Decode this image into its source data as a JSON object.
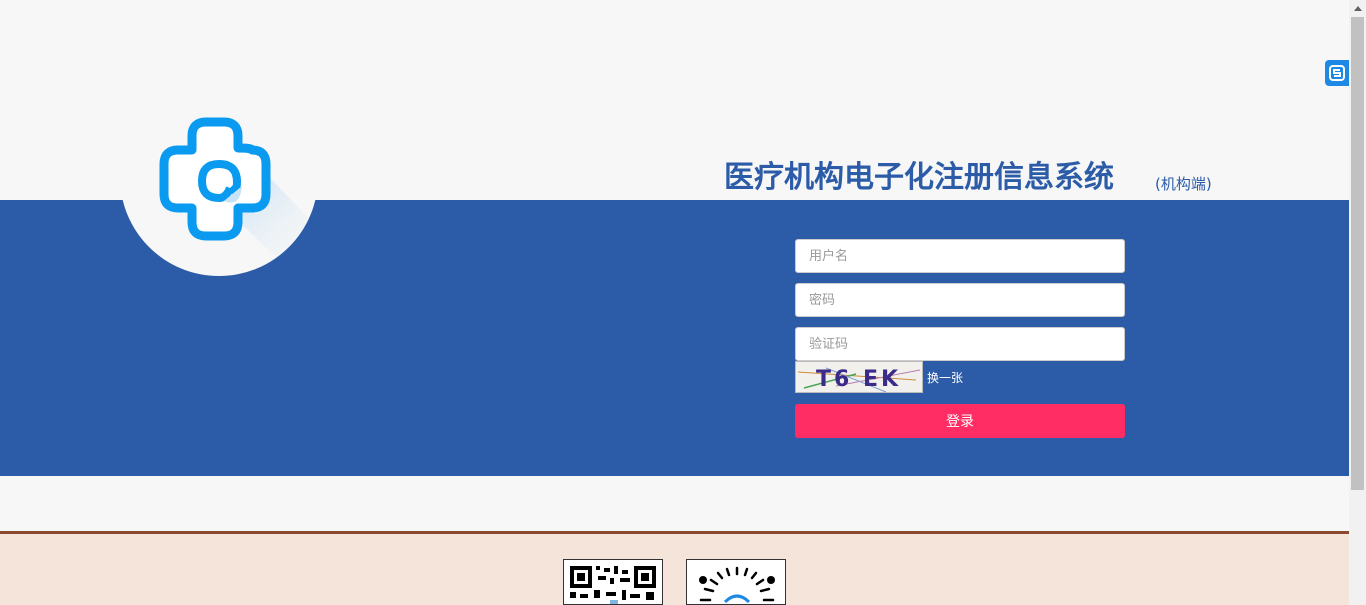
{
  "header": {
    "title": "医疗机构电子化注册信息系统",
    "subtitle": "(机构端)"
  },
  "login_form": {
    "username_placeholder": "用户名",
    "password_placeholder": "密码",
    "captcha_placeholder": "验证码",
    "captcha_text": "T6 EK",
    "refresh_label": "换一张",
    "submit_label": "登录"
  },
  "colors": {
    "brand_blue": "#2c5ca8",
    "submit_pink": "#ff2d63",
    "logo_blue": "#0a9af0",
    "footer_bg": "#f5e4da",
    "footer_border": "#8a4a2e"
  },
  "icons": {
    "logo": "medical-cross-logo-icon",
    "float_tool": "s-tool-icon"
  }
}
